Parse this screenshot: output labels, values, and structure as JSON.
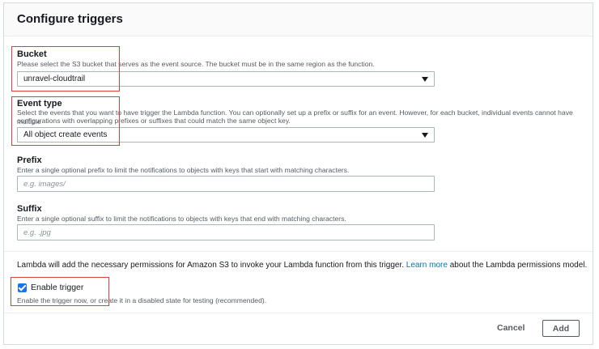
{
  "header": {
    "title": "Configure triggers"
  },
  "bucket": {
    "label": "Bucket",
    "description": "Please select the S3 bucket that serves as the event source. The bucket must be in the same region as the function.",
    "value": "unravel-cloudtrail"
  },
  "event_type": {
    "label": "Event type",
    "description_line1": "Select the events that you want to have trigger the Lambda function. You can optionally set up a prefix or suffix for an event. However, for each bucket, individual events cannot have multiple",
    "description_line2": "configurations with overlapping prefixes or suffixes that could match the same object key.",
    "value": "All object create events"
  },
  "prefix": {
    "label": "Prefix",
    "description": "Enter a single optional prefix to limit the notifications to objects with keys that start with matching characters.",
    "placeholder": "e.g. images/"
  },
  "suffix": {
    "label": "Suffix",
    "description": "Enter a single optional suffix to limit the notifications to objects with keys that end with matching characters.",
    "placeholder": "e.g. .jpg"
  },
  "permissions": {
    "text_before": "Lambda will add the necessary permissions for Amazon S3 to invoke your Lambda function from this trigger. ",
    "link": "Learn more",
    "text_after": " about the Lambda permissions model."
  },
  "enable_trigger": {
    "label": "Enable trigger",
    "checked": true,
    "description": "Enable the trigger now, or create it in a disabled state for testing (recommended)."
  },
  "footer": {
    "cancel_label": "Cancel",
    "add_label": "Add"
  },
  "colors": {
    "highlight": "#e0403a",
    "link": "#0073bb",
    "checkbox": "#1a73e8"
  }
}
